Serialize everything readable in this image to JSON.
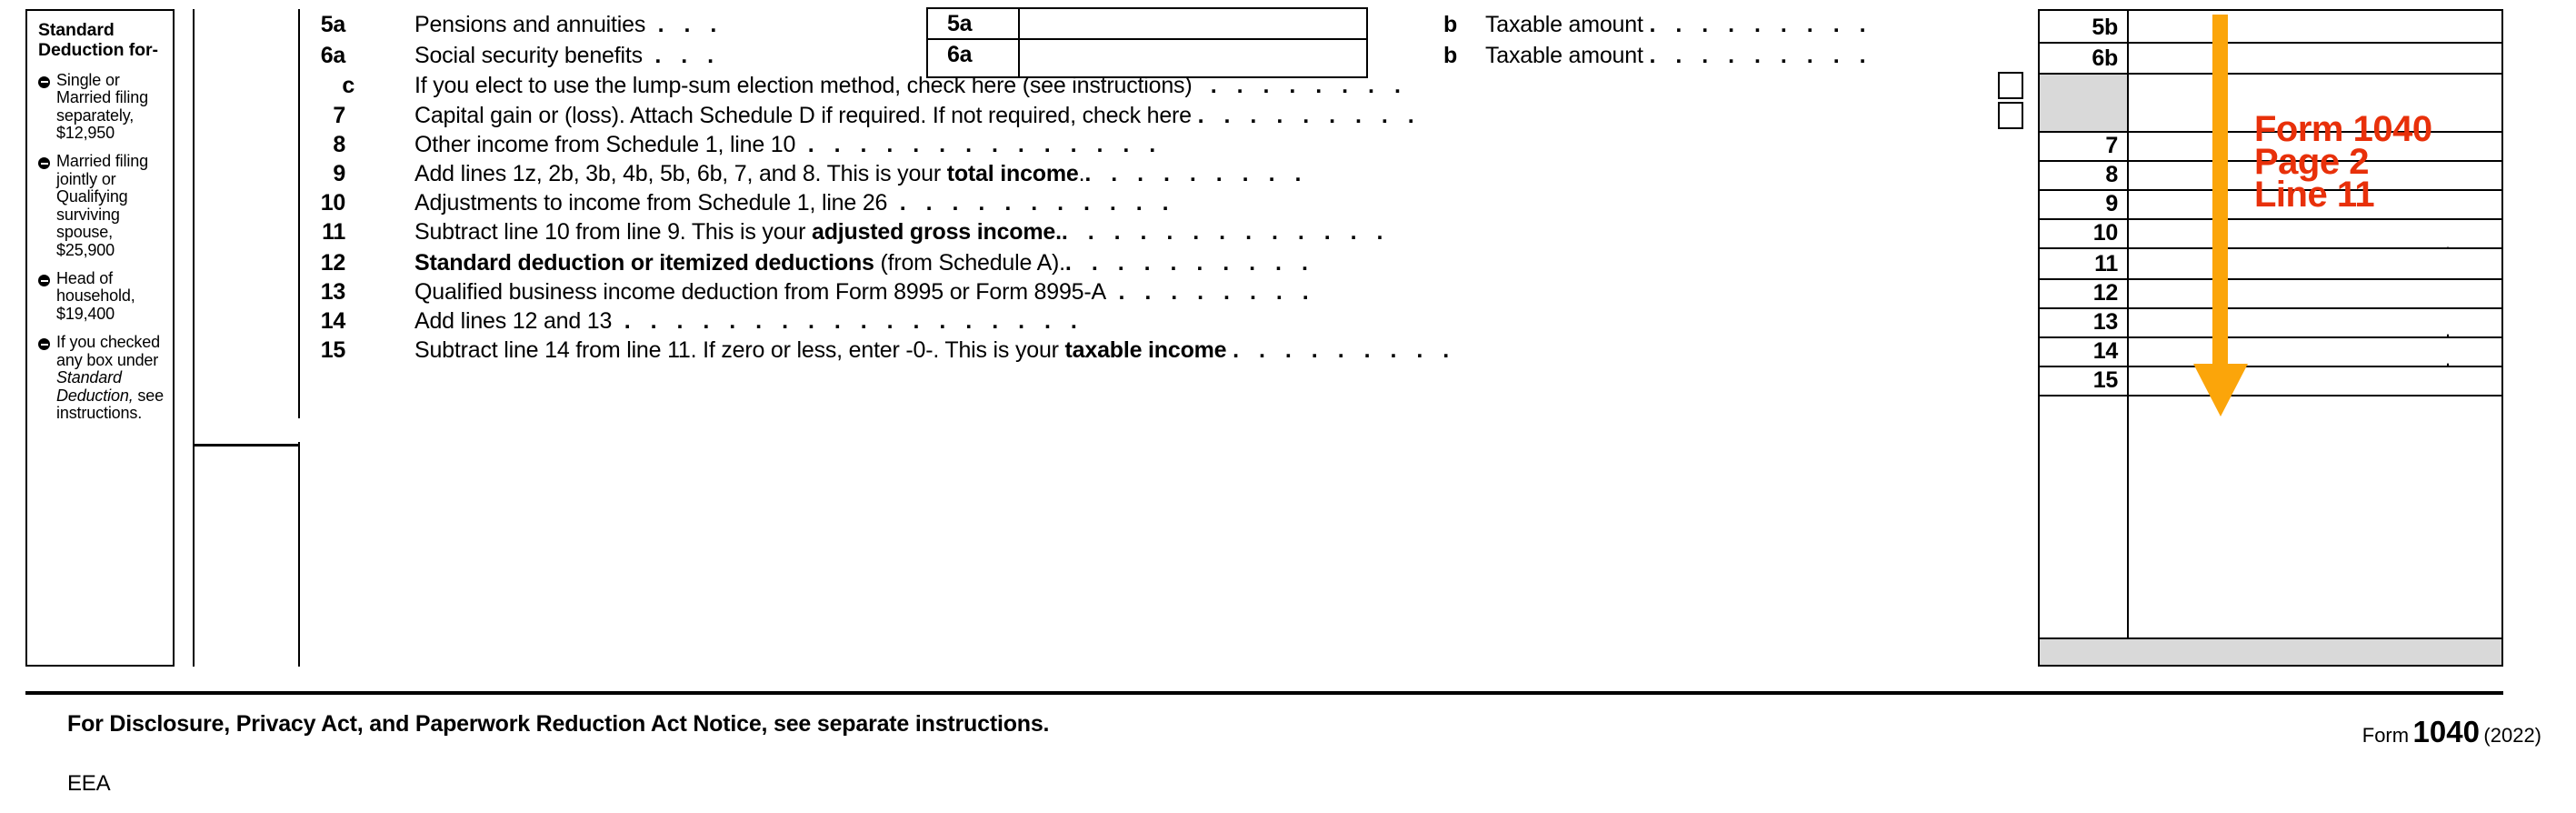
{
  "sidebar": {
    "title_line1": "Standard",
    "title_line2": "Deduction for-",
    "items": [
      {
        "text": "Single or Married filing separately, $12,950"
      },
      {
        "text": "Married filing jointly or Qualifying surviving spouse, $25,900"
      },
      {
        "text": "Head of household, $19,400"
      },
      {
        "text_before": "If you checked any box under ",
        "text_italic": "Standard Deduction,",
        "text_after": " see instructions."
      }
    ]
  },
  "rows": [
    {
      "num": "5a",
      "text": "Pensions and annuities",
      "leader": ". . .",
      "box_tag": "5a",
      "box_value": "",
      "b_letter": "b",
      "b_text": "Taxable amount",
      "b_leader": ". . . . . . . . .",
      "grid_num": "5b",
      "grid_value": ""
    },
    {
      "num": "6a",
      "text": "Social security benefits",
      "leader": ". . .",
      "box_tag": "6a",
      "box_value": "",
      "b_letter": "b",
      "b_text": "Taxable amount",
      "b_leader": ". . . . . . . . .",
      "grid_num": "6b",
      "grid_value": ""
    },
    {
      "num": "c",
      "text": "If you elect to use the lump-sum election method, check here (see instructions)",
      "leader": ". . . . . . . .",
      "checkbox": true,
      "grid_num": "",
      "grid_value": ""
    },
    {
      "num": "7",
      "text": "Capital gain or (loss). Attach Schedule D if required. If not required, check here",
      "leader": ". . . . . . . . .",
      "checkbox": true,
      "grid_num": "7",
      "grid_value": ""
    },
    {
      "num": "8",
      "text": "Other income from Schedule 1, line 10",
      "leader": ". . . . . . . . . . . . . .",
      "grid_num": "8",
      "grid_value": ""
    },
    {
      "num": "9",
      "text_plain": "Add lines 1z, 2b, 3b, 4b, 5b, 6b, 7, and 8. This is your ",
      "text_bold": "total income",
      "text_tail": ".",
      "leader": ". . . . . . . . .",
      "grid_num": "9",
      "grid_value": ""
    },
    {
      "num": "10",
      "text": "Adjustments to income from Schedule 1, line 26",
      "leader": ". . . . . . . . . . .",
      "grid_num": "10",
      "grid_value": ""
    },
    {
      "num": "11",
      "text_plain": "Subtract line 10 from line 9. This is your ",
      "text_bold": "adjusted gross income.",
      "text_tail": "",
      "leader": ". . . . . . . . . . . . .",
      "grid_num": "11",
      "grid_value": ""
    },
    {
      "num": "12",
      "text_bold_lead": "Standard deduction or itemized deductions",
      "text_plain": " (from Schedule A)",
      "text_tail": ".",
      "leader": ". . . . . . . . . .",
      "grid_num": "12",
      "grid_value": ""
    },
    {
      "num": "13",
      "text": "Qualified business income deduction from Form 8995 or Form 8995-A",
      "leader": ". . . . . . . .",
      "grid_num": "13",
      "grid_value": ""
    },
    {
      "num": "14",
      "text": "Add lines 12 and 13",
      "leader": ". . . . . . . . . . . . . . . . . .",
      "grid_num": "14",
      "grid_value": ""
    },
    {
      "num": "15",
      "text_plain": "Subtract line 14 from line 11. If zero or less, enter -0-. This is your ",
      "text_bold": "taxable income",
      "text_tail": "",
      "leader": ". . . . . . . . .",
      "grid_num": "15",
      "grid_value": ""
    }
  ],
  "annotation": {
    "line1": "Form 1040",
    "line2": "Page 2",
    "line3": "Line 11",
    "arrow_color": "#FBA50A",
    "text_color": "#E8300A"
  },
  "footer": {
    "notice": "For Disclosure, Privacy Act, and Paperwork Reduction Act Notice, see separate instructions.",
    "eea": "EEA",
    "form_word": "Form",
    "form_number": "1040",
    "form_year": "(2022)"
  }
}
